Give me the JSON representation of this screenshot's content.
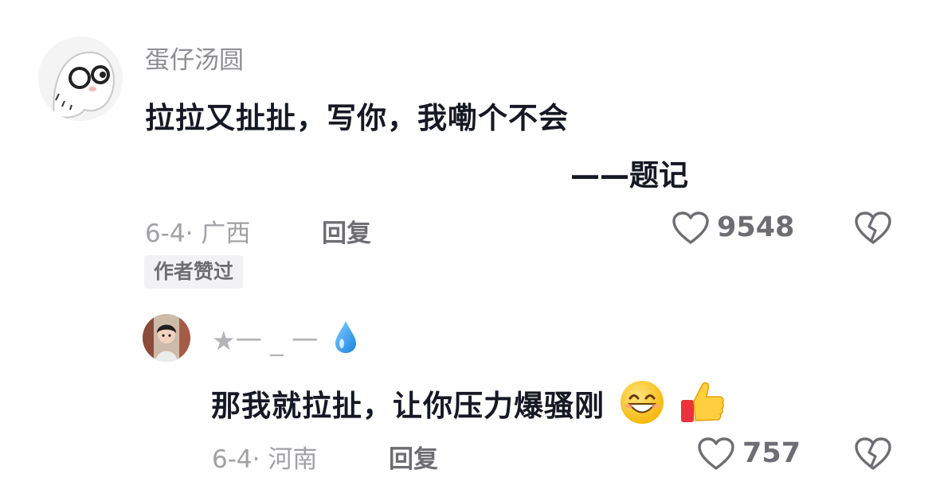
{
  "comment": {
    "author": "蛋仔汤圆",
    "body": "拉拉又扯扯，写你，我嘞个不会",
    "signature": "——题记",
    "meta": "6-4· 广西",
    "reply_label": "回复",
    "likes": "9548",
    "badge": "作者赞过",
    "avatar_icon": "cartoon-avatar-icon",
    "colors": {
      "text": "#161823",
      "muted": "#a0a0a5"
    }
  },
  "reply": {
    "author": "★一 _ 一",
    "body": "那我就拉扯，让你压力爆骚刚",
    "meta": "6-4· 河南",
    "reply_label": "回复",
    "likes": "757",
    "avatar_icon": "person-avatar-icon"
  }
}
